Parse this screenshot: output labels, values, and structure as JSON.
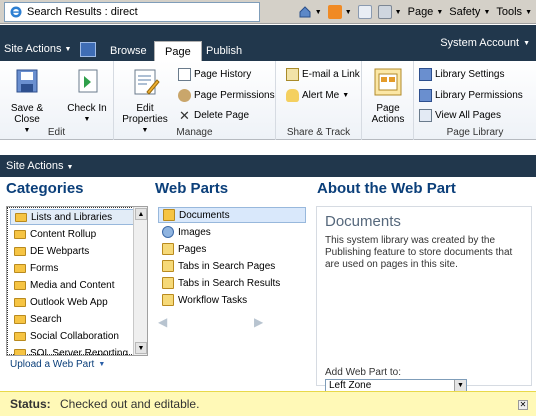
{
  "browser": {
    "tab_title": "Search Results : direct",
    "tools": {
      "page": "Page",
      "safety": "Safety",
      "tools": "Tools"
    }
  },
  "ribbon": {
    "site_actions": "Site Actions",
    "tabs": [
      "Browse",
      "Page",
      "Publish"
    ],
    "active_tab": "Page",
    "account": "System Account",
    "groups": {
      "edit": {
        "label": "Edit",
        "save_close": "Save & Close",
        "check_in": "Check In"
      },
      "manage": {
        "label": "Manage",
        "edit_properties": "Edit Properties",
        "page_history": "Page History",
        "page_permissions": "Page Permissions",
        "delete_page": "Delete Page"
      },
      "share": {
        "label": "Share & Track",
        "email_link": "E-mail a Link",
        "alert_me": "Alert Me"
      },
      "page_actions": {
        "label": "Page Actions"
      },
      "library": {
        "label": "Page Library",
        "settings": "Library Settings",
        "permissions": "Library Permissions",
        "view_all": "View All Pages"
      }
    }
  },
  "site_actions_bar": {
    "label": "Site Actions"
  },
  "adder": {
    "categories_title": "Categories",
    "webparts_title": "Web Parts",
    "about_title": "About the Web Part",
    "categories": [
      "Lists and Libraries",
      "Content Rollup",
      "DE Webparts",
      "Forms",
      "Media and Content",
      "Outlook Web App",
      "Search",
      "Social Collaboration",
      "SQL Server Reporting"
    ],
    "upload": "Upload a Web Part",
    "web_parts": [
      "Documents",
      "Images",
      "Pages",
      "Tabs in Search Pages",
      "Tabs in Search Results",
      "Workflow Tasks"
    ],
    "about": {
      "name": "Documents",
      "description": "This system library was created by the Publishing feature to store documents that are used on pages in this site.",
      "add_label": "Add Web Part to:",
      "zone": "Left Zone"
    }
  },
  "status": {
    "label": "Status:",
    "text": "Checked out and editable."
  }
}
